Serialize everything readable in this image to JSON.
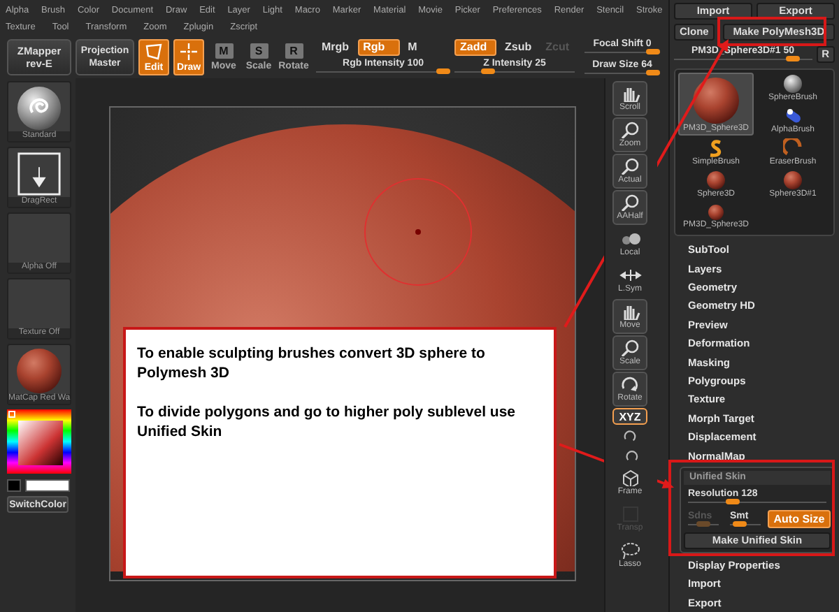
{
  "menu": {
    "row_1": [
      "Alpha",
      "Brush",
      "Color",
      "Document",
      "Draw",
      "Edit",
      "Layer",
      "Light",
      "Macro",
      "Marker",
      "Material",
      "Movie",
      "Picker",
      "Preferences",
      "Render",
      "Stencil",
      "Stroke"
    ],
    "row_2": [
      "Texture",
      "Tool",
      "Transform",
      "Zoom",
      "Zplugin",
      "Zscript"
    ]
  },
  "toolbar": {
    "plugins": [
      {
        "label": "ZMapper rev-E"
      },
      {
        "label": "Projection Master"
      }
    ],
    "modes": [
      {
        "kind": "edit",
        "label": "Edit",
        "on": true
      },
      {
        "kind": "draw",
        "label": "Draw",
        "on": true
      },
      {
        "kind": "letter",
        "letter": "M",
        "label": "Move",
        "on": false
      },
      {
        "kind": "letter",
        "letter": "S",
        "label": "Scale",
        "on": false
      },
      {
        "kind": "letter",
        "letter": "R",
        "label": "Rotate",
        "on": false
      }
    ],
    "color_modes": [
      {
        "label": "Mrgb",
        "on": false
      },
      {
        "label": "Rgb",
        "on": true
      },
      {
        "label": "M",
        "on": false
      }
    ],
    "rgb_intensity": {
      "label": "Rgb Intensity 100",
      "level": 1
    },
    "z_modes": [
      {
        "label": "Zadd",
        "on": true,
        "disabled": false
      },
      {
        "label": "Zsub",
        "on": false,
        "disabled": false
      },
      {
        "label": "Zcut",
        "on": false,
        "disabled": true
      }
    ],
    "z_intensity": {
      "label": "Z Intensity 25",
      "level": 0.25
    },
    "focal_shift": {
      "label": "Focal Shift 0",
      "level": 1
    },
    "draw_size": {
      "label": "Draw Size 64",
      "level": 1
    }
  },
  "tray": {
    "items": [
      {
        "kind": "brush",
        "label": "Standard"
      },
      {
        "kind": "stroke",
        "label": "DragRect"
      },
      {
        "kind": "empty",
        "label": "Alpha Off"
      },
      {
        "kind": "empty",
        "label": "Texture Off"
      },
      {
        "kind": "material",
        "label": "MatCap Red Wa"
      }
    ],
    "switch_color": "SwitchColor"
  },
  "canvas": {
    "callout": [
      "To enable sculpting brushes convert 3D sphere to Polymesh 3D",
      "To divide polygons and go to higher poly sublevel use Unified Skin"
    ]
  },
  "strip": [
    {
      "kind": "framed",
      "label": "Scroll",
      "on": false,
      "disabled": false
    },
    {
      "kind": "framed",
      "label": "Zoom",
      "on": false,
      "disabled": false
    },
    {
      "kind": "framed",
      "label": "Actual",
      "on": false,
      "disabled": false
    },
    {
      "kind": "framed",
      "label": "AAHalf",
      "on": false,
      "disabled": false
    },
    {
      "kind": "plain",
      "label": "Local",
      "on": false,
      "disabled": false
    },
    {
      "kind": "plain",
      "label": "L.Sym",
      "on": false,
      "disabled": false
    },
    {
      "kind": "framed",
      "label": "Move",
      "on": false,
      "disabled": false
    },
    {
      "kind": "framed",
      "label": "Scale",
      "on": false,
      "disabled": false
    },
    {
      "kind": "framed",
      "label": "Rotate",
      "on": false,
      "disabled": false
    },
    {
      "kind": "toggle",
      "label": "XYZ",
      "on": true,
      "disabled": false
    },
    {
      "kind": "small",
      "on": false,
      "disabled": false
    },
    {
      "kind": "small",
      "on": false,
      "disabled": false
    },
    {
      "kind": "plain",
      "label": "Frame",
      "on": false,
      "disabled": false
    },
    {
      "kind": "plain",
      "label": "Transp",
      "on": false,
      "disabled": true
    },
    {
      "kind": "plain",
      "label": "Lasso",
      "on": false,
      "disabled": false
    }
  ],
  "tool_panel": {
    "top_buttons": [
      "Import",
      "Export"
    ],
    "clone": "Clone",
    "make_polymesh": "Make PolyMesh3D",
    "current_tool": {
      "label": "PM3D_Sphere3D#1 50",
      "level": 0.9
    },
    "r_button": "R",
    "tools": [
      {
        "kind": "small",
        "label": "SphereBrush",
        "selected": false
      },
      {
        "kind": "large",
        "label": "PM3D_Sphere3D",
        "selected": true
      },
      {
        "kind": "small",
        "label": "AlphaBrush",
        "selected": false
      },
      {
        "kind": "small",
        "label": "SimpleBrush",
        "selected": false
      },
      {
        "kind": "small",
        "label": "EraserBrush",
        "selected": false
      },
      {
        "kind": "small",
        "label": "Sphere3D",
        "selected": false
      },
      {
        "kind": "small",
        "label": "Sphere3D#1",
        "selected": false
      },
      {
        "kind": "small",
        "label": "PM3D_Sphere3D",
        "selected": false
      }
    ],
    "sections": [
      "SubTool",
      "Layers",
      "Geometry",
      "Geometry HD",
      "Preview",
      "Deformation",
      "Masking",
      "Polygroups",
      "Texture",
      "Morph Target",
      "Displacement",
      "NormalMap"
    ],
    "unified_skin": {
      "title": "Unified Skin",
      "resolution": {
        "label": "Resolution 128",
        "level": 0.3
      },
      "sdns": {
        "label": "Sdns",
        "disabled": true,
        "level": 0.5
      },
      "smt": {
        "label": "Smt",
        "disabled": false,
        "level": 0.2
      },
      "auto_size": {
        "label": "Auto Size",
        "on": true
      },
      "make": "Make Unified Skin"
    },
    "sections_after": [
      "Display Properties",
      "Import",
      "Export"
    ]
  }
}
